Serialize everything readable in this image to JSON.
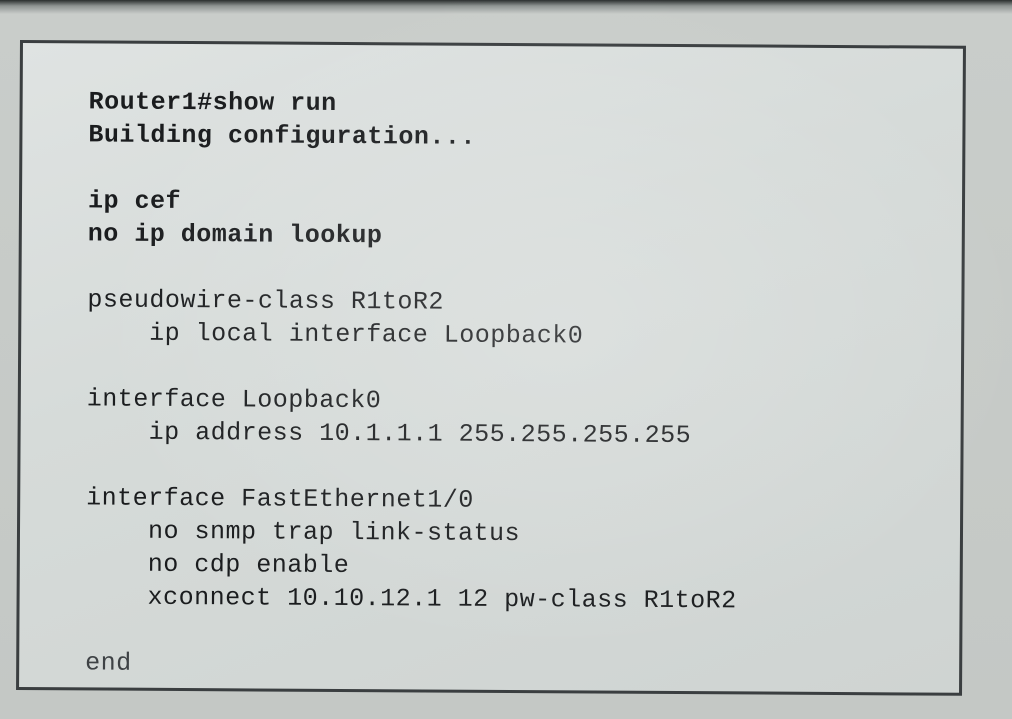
{
  "terminal": {
    "lines": [
      {
        "text": "Router1#show run",
        "bold": true,
        "indent": false
      },
      {
        "text": "Building configuration...",
        "bold": true,
        "indent": false
      },
      {
        "text": "",
        "bold": false,
        "indent": false
      },
      {
        "text": "ip cef",
        "bold": true,
        "indent": false
      },
      {
        "text": "no ip domain lookup",
        "bold": true,
        "indent": false
      },
      {
        "text": "",
        "bold": false,
        "indent": false
      },
      {
        "text": "pseudowire-class R1toR2",
        "bold": false,
        "indent": false
      },
      {
        "text": "ip local interface Loopback0",
        "bold": false,
        "indent": true
      },
      {
        "text": "",
        "bold": false,
        "indent": false
      },
      {
        "text": "interface Loopback0",
        "bold": false,
        "indent": false
      },
      {
        "text": "ip address 10.1.1.1 255.255.255.255",
        "bold": false,
        "indent": true
      },
      {
        "text": "",
        "bold": false,
        "indent": false
      },
      {
        "text": "interface FastEthernet1/0",
        "bold": false,
        "indent": false
      },
      {
        "text": "no snmp trap link-status",
        "bold": false,
        "indent": true
      },
      {
        "text": "no cdp enable",
        "bold": false,
        "indent": true
      },
      {
        "text": "xconnect 10.10.12.1 12 pw-class R1toR2",
        "bold": false,
        "indent": true
      },
      {
        "text": "",
        "bold": false,
        "indent": false
      },
      {
        "text": "end",
        "bold": false,
        "indent": false
      }
    ]
  }
}
